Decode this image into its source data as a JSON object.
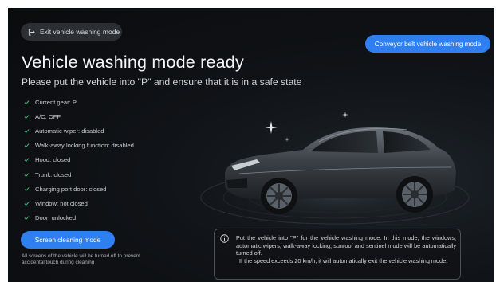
{
  "header": {
    "exit_label": "Exit vehicle washing mode",
    "conveyor_label": "Conveyor belt vehicle washing mode"
  },
  "main": {
    "title": "Vehicle washing mode ready",
    "subtitle": "Please put the vehicle into \"P\" and ensure that it is in a safe state"
  },
  "status_items": [
    "Current gear: P",
    "A/C: OFF",
    "Automatic wiper: disabled",
    "Walk-away locking function: disabled",
    "Hood: closed",
    "Trunk: closed",
    "Charging port door: closed",
    "Window: not closed",
    "Door: unlocked"
  ],
  "screen_cleaning": {
    "button_label": "Screen cleaning mode",
    "note": "All screens of the vehicle will be turned off to prevent accidental touch during cleaning"
  },
  "info": {
    "line1": "Put the vehicle into \"P\" for the vehicle washing mode. In this mode, the windows, automatic wipers, walk-away locking, sunroof and sentinel mode will be automatically turned off.",
    "line2": "If the speed exceeds 20 km/h, it will automatically exit the vehicle washing mode."
  },
  "colors": {
    "accent": "#2f7ff0",
    "check": "#2fbf71",
    "background": "#0d0f12"
  },
  "icons": {
    "exit": "exit-icon",
    "check": "check-icon",
    "info": "info-icon",
    "sparkle": "sparkle-icon",
    "car": "car-image"
  }
}
